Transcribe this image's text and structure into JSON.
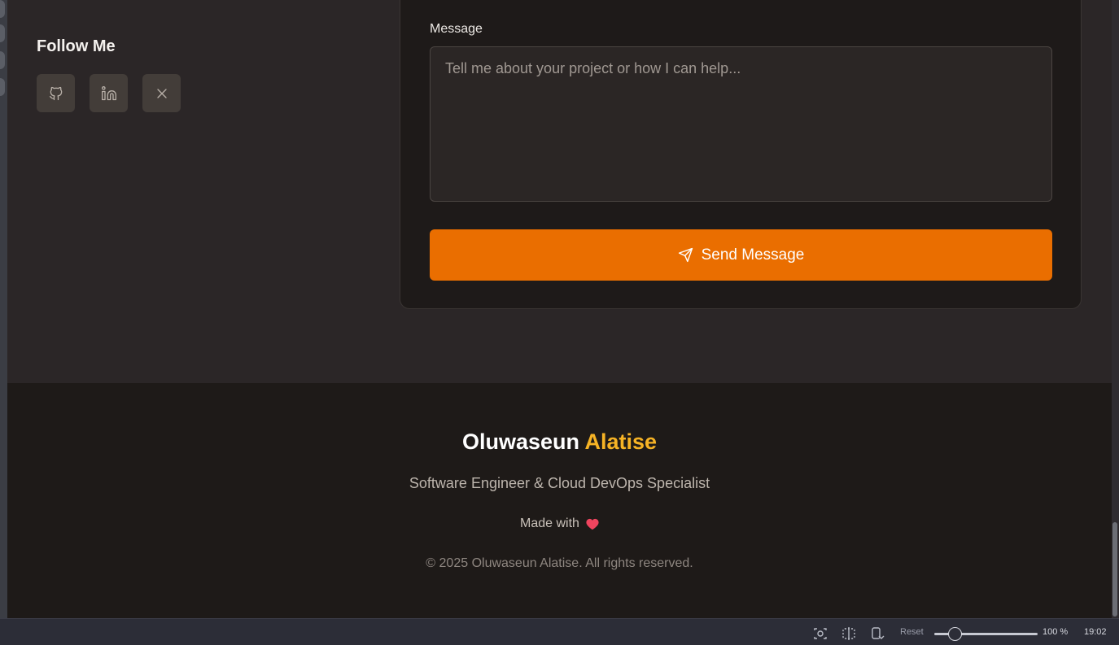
{
  "follow": {
    "title": "Follow Me",
    "socials": [
      {
        "name": "GitHub",
        "icon": "github-icon"
      },
      {
        "name": "LinkedIn",
        "icon": "linkedin-icon"
      },
      {
        "name": "X",
        "icon": "x-icon"
      }
    ]
  },
  "form": {
    "message_label": "Message",
    "message_placeholder": "Tell me about your project or how I can help...",
    "send_label": "Send Message",
    "send_icon": "send-icon"
  },
  "footer": {
    "name_first": "Oluwaseun",
    "name_last": "Alatise",
    "tagline": "Software Engineer & Cloud DevOps Specialist",
    "made_with": "Made with",
    "heart_icon": "heart-icon",
    "copyright": "© 2025 Oluwaseun Alatise. All rights reserved."
  },
  "taskbar": {
    "reset_label": "Reset",
    "zoom": "100 %",
    "time": "19:02",
    "zoom_fraction": 0.2
  },
  "colors": {
    "accent_orange": "#ea6e00",
    "accent_gold": "#f6b325",
    "heart": "#f0445e",
    "page_bg": "#2b2627",
    "footer_bg": "#1e1a18"
  }
}
